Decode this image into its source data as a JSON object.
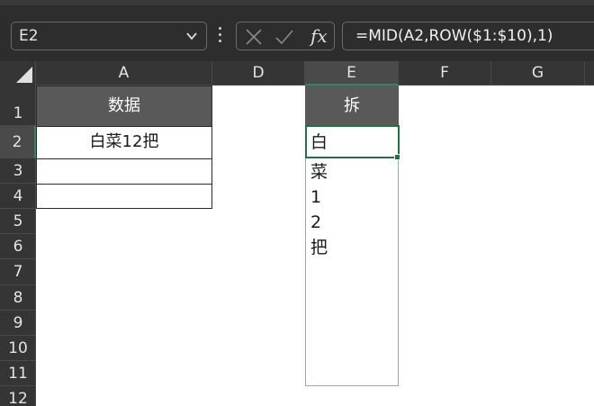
{
  "formula_bar": {
    "name_box": "E2",
    "formula": "=MID(A2,ROW($1:$10),1)",
    "cancel_icon": "close-icon",
    "enter_icon": "checkmark-icon",
    "fx_label": "fx"
  },
  "columns": [
    "A",
    "D",
    "E",
    "F",
    "G"
  ],
  "rows": [
    "1",
    "2",
    "3",
    "4",
    "5",
    "6",
    "7",
    "8",
    "9",
    "10",
    "11",
    "12"
  ],
  "cells": {
    "A1": "数据",
    "A2": "白菜12把",
    "E1": "拆"
  },
  "split_result": [
    "白",
    "菜",
    "1",
    "2",
    "把"
  ],
  "colors": {
    "dark_chrome": "#2d2d2d",
    "header_fill": "#595959",
    "selection": "#217346"
  }
}
